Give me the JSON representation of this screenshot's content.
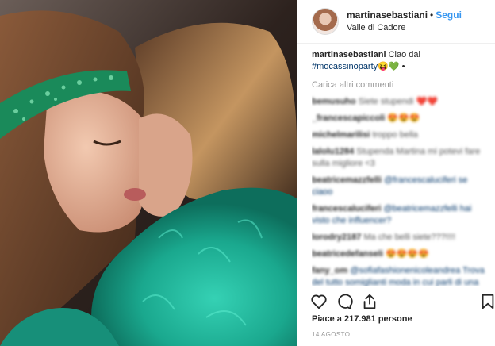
{
  "header": {
    "username": "martinasebastiani",
    "separator": "•",
    "follow_label": "Segui",
    "location": "Valle di Cadore"
  },
  "caption": {
    "username": "martinasebastiani",
    "text": "Ciao dal",
    "hashtag": "#mocassinoparty",
    "emoji": "😝💚 •"
  },
  "load_more_label": "Carica altri commenti",
  "comments": [
    {
      "user": "bemusuho",
      "text": "Siete stupendi ❤️❤️"
    },
    {
      "user": "_francescapiccoli",
      "text": "😍😍😍"
    },
    {
      "user": "michelmarilisi",
      "text": "troppo bella"
    },
    {
      "user": "lalolu1284",
      "text": "Stupenda Martina mi potevi fare sulla migliore <3"
    },
    {
      "user": "beatricemazzfelli",
      "text": "@francescaluciferi se ciaoo"
    },
    {
      "user": "francescaluciferi",
      "text": "@beatricemazzfelli hai visto che influencer?"
    },
    {
      "user": "lorodry2187",
      "text": "Ma che belli siete???!!!!"
    },
    {
      "user": "beatricedefanseli",
      "text": "😍😍😍😍"
    },
    {
      "user": "fany_om",
      "text": "@sofiafashionenicoleandrea Trova del tutto somiglianti moda in cui parli di una tua spiaggia mezza, ancora una"
    }
  ],
  "likes_text": "Piace a 217.981 persone",
  "date_text": "14 agosto",
  "icons": [
    "heart-icon",
    "comment-icon",
    "share-icon",
    "bookmark-icon"
  ],
  "colors": {
    "link": "#3897f0",
    "muted": "#999999",
    "fur": "#1fb59a",
    "headband": "#1a8a5a"
  }
}
